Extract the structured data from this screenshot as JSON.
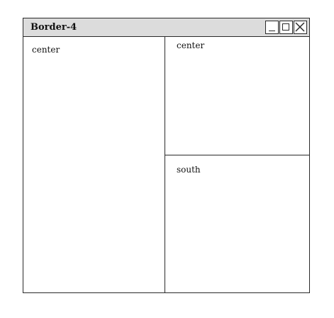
{
  "window": {
    "title": "Border-4",
    "buttons": [
      "minimize-icon",
      "maximize-icon",
      "close-icon"
    ]
  },
  "panes": {
    "left_label": "center",
    "right_top_label": "center",
    "right_bottom_label": "south"
  }
}
